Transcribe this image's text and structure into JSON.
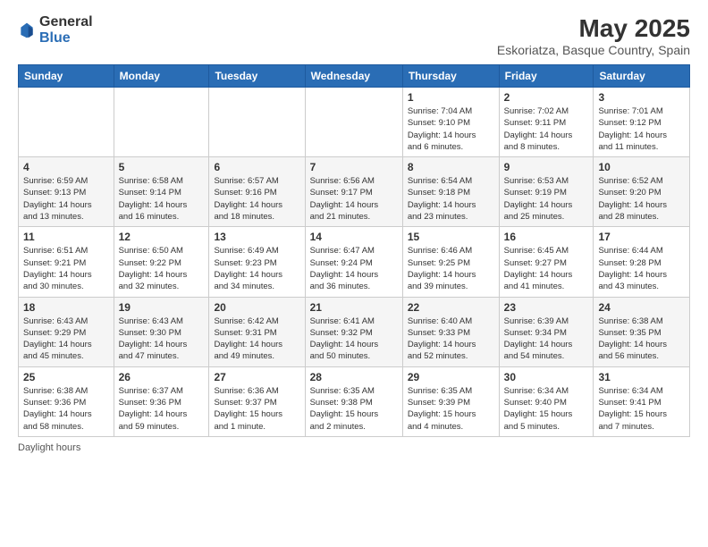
{
  "logo": {
    "general": "General",
    "blue": "Blue"
  },
  "header": {
    "month": "May 2025",
    "location": "Eskoriatza, Basque Country, Spain"
  },
  "days_of_week": [
    "Sunday",
    "Monday",
    "Tuesday",
    "Wednesday",
    "Thursday",
    "Friday",
    "Saturday"
  ],
  "footer": {
    "daylight_label": "Daylight hours"
  },
  "weeks": [
    [
      {
        "day": "",
        "info": ""
      },
      {
        "day": "",
        "info": ""
      },
      {
        "day": "",
        "info": ""
      },
      {
        "day": "",
        "info": ""
      },
      {
        "day": "1",
        "info": "Sunrise: 7:04 AM\nSunset: 9:10 PM\nDaylight: 14 hours\nand 6 minutes."
      },
      {
        "day": "2",
        "info": "Sunrise: 7:02 AM\nSunset: 9:11 PM\nDaylight: 14 hours\nand 8 minutes."
      },
      {
        "day": "3",
        "info": "Sunrise: 7:01 AM\nSunset: 9:12 PM\nDaylight: 14 hours\nand 11 minutes."
      }
    ],
    [
      {
        "day": "4",
        "info": "Sunrise: 6:59 AM\nSunset: 9:13 PM\nDaylight: 14 hours\nand 13 minutes."
      },
      {
        "day": "5",
        "info": "Sunrise: 6:58 AM\nSunset: 9:14 PM\nDaylight: 14 hours\nand 16 minutes."
      },
      {
        "day": "6",
        "info": "Sunrise: 6:57 AM\nSunset: 9:16 PM\nDaylight: 14 hours\nand 18 minutes."
      },
      {
        "day": "7",
        "info": "Sunrise: 6:56 AM\nSunset: 9:17 PM\nDaylight: 14 hours\nand 21 minutes."
      },
      {
        "day": "8",
        "info": "Sunrise: 6:54 AM\nSunset: 9:18 PM\nDaylight: 14 hours\nand 23 minutes."
      },
      {
        "day": "9",
        "info": "Sunrise: 6:53 AM\nSunset: 9:19 PM\nDaylight: 14 hours\nand 25 minutes."
      },
      {
        "day": "10",
        "info": "Sunrise: 6:52 AM\nSunset: 9:20 PM\nDaylight: 14 hours\nand 28 minutes."
      }
    ],
    [
      {
        "day": "11",
        "info": "Sunrise: 6:51 AM\nSunset: 9:21 PM\nDaylight: 14 hours\nand 30 minutes."
      },
      {
        "day": "12",
        "info": "Sunrise: 6:50 AM\nSunset: 9:22 PM\nDaylight: 14 hours\nand 32 minutes."
      },
      {
        "day": "13",
        "info": "Sunrise: 6:49 AM\nSunset: 9:23 PM\nDaylight: 14 hours\nand 34 minutes."
      },
      {
        "day": "14",
        "info": "Sunrise: 6:47 AM\nSunset: 9:24 PM\nDaylight: 14 hours\nand 36 minutes."
      },
      {
        "day": "15",
        "info": "Sunrise: 6:46 AM\nSunset: 9:25 PM\nDaylight: 14 hours\nand 39 minutes."
      },
      {
        "day": "16",
        "info": "Sunrise: 6:45 AM\nSunset: 9:27 PM\nDaylight: 14 hours\nand 41 minutes."
      },
      {
        "day": "17",
        "info": "Sunrise: 6:44 AM\nSunset: 9:28 PM\nDaylight: 14 hours\nand 43 minutes."
      }
    ],
    [
      {
        "day": "18",
        "info": "Sunrise: 6:43 AM\nSunset: 9:29 PM\nDaylight: 14 hours\nand 45 minutes."
      },
      {
        "day": "19",
        "info": "Sunrise: 6:43 AM\nSunset: 9:30 PM\nDaylight: 14 hours\nand 47 minutes."
      },
      {
        "day": "20",
        "info": "Sunrise: 6:42 AM\nSunset: 9:31 PM\nDaylight: 14 hours\nand 49 minutes."
      },
      {
        "day": "21",
        "info": "Sunrise: 6:41 AM\nSunset: 9:32 PM\nDaylight: 14 hours\nand 50 minutes."
      },
      {
        "day": "22",
        "info": "Sunrise: 6:40 AM\nSunset: 9:33 PM\nDaylight: 14 hours\nand 52 minutes."
      },
      {
        "day": "23",
        "info": "Sunrise: 6:39 AM\nSunset: 9:34 PM\nDaylight: 14 hours\nand 54 minutes."
      },
      {
        "day": "24",
        "info": "Sunrise: 6:38 AM\nSunset: 9:35 PM\nDaylight: 14 hours\nand 56 minutes."
      }
    ],
    [
      {
        "day": "25",
        "info": "Sunrise: 6:38 AM\nSunset: 9:36 PM\nDaylight: 14 hours\nand 58 minutes."
      },
      {
        "day": "26",
        "info": "Sunrise: 6:37 AM\nSunset: 9:36 PM\nDaylight: 14 hours\nand 59 minutes."
      },
      {
        "day": "27",
        "info": "Sunrise: 6:36 AM\nSunset: 9:37 PM\nDaylight: 15 hours\nand 1 minute."
      },
      {
        "day": "28",
        "info": "Sunrise: 6:35 AM\nSunset: 9:38 PM\nDaylight: 15 hours\nand 2 minutes."
      },
      {
        "day": "29",
        "info": "Sunrise: 6:35 AM\nSunset: 9:39 PM\nDaylight: 15 hours\nand 4 minutes."
      },
      {
        "day": "30",
        "info": "Sunrise: 6:34 AM\nSunset: 9:40 PM\nDaylight: 15 hours\nand 5 minutes."
      },
      {
        "day": "31",
        "info": "Sunrise: 6:34 AM\nSunset: 9:41 PM\nDaylight: 15 hours\nand 7 minutes."
      }
    ]
  ]
}
